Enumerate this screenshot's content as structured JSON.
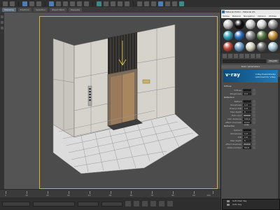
{
  "toolbar": {
    "tab_a": "Object Paint",
    "tab_b": "Populate"
  },
  "ribbon": {
    "tabs": [
      "Modeling",
      "Freeform",
      "Selection",
      "Object Paint",
      "Populate"
    ],
    "active": 0
  },
  "viewport": {
    "label": "[+] [Perspective] [Standard] [Default Shading]"
  },
  "timeline": {
    "ticks": [
      "0",
      "10",
      "20",
      "30",
      "40",
      "50",
      "60",
      "70",
      "80",
      "90",
      "100"
    ]
  },
  "material_editor": {
    "title": "Material Editor - Material #1",
    "menu": [
      "Modes",
      "Material",
      "Navigation",
      "Options",
      "Utilities"
    ],
    "material_name": "Material #1",
    "type_button": "VRayMtl",
    "rollout_basic": "Basic parameters",
    "vray_logo": "v·ray",
    "vray_tagline": "V-Ray PowerShader",
    "vray_tagline2": "optimized for V-Ray",
    "diffuse_section": "Diffuse",
    "reflection_section": "Reflection",
    "refraction_section": "Refraction",
    "sphere_colors": [
      "#c8c8c8",
      "#101010",
      "#cfcfcf",
      "#d9d9d9",
      "#9e9e9e",
      "#3aa0b8",
      "#2e6cc0",
      "#8a8a8a",
      "#5a7d45",
      "#c9963a",
      "#c04b3d",
      "#6fa0c8",
      "#d8d3c0",
      "#6b6b6b",
      "#a8c8d8"
    ],
    "rows_diffuse": [
      {
        "label": "Diffuse",
        "value": ""
      },
      {
        "label": "Roughness",
        "value": "0.0"
      }
    ],
    "rows_reflect": [
      {
        "label": "Reflect",
        "value": ""
      },
      {
        "label": "Glossiness",
        "value": "1.0"
      },
      {
        "label": "Fresnel IOR",
        "value": "1.6"
      },
      {
        "label": "Max depth",
        "value": "5"
      },
      {
        "label": "Exit color",
        "value": ""
      },
      {
        "label": "Dim distance",
        "value": "100.0"
      },
      {
        "label": "Affect channels",
        "value": "Color only"
      }
    ],
    "rows_refract": [
      {
        "label": "Refract",
        "value": ""
      },
      {
        "label": "Glossiness",
        "value": "1.0"
      },
      {
        "label": "IOR",
        "value": "1.6"
      },
      {
        "label": "Max depth",
        "value": "5"
      },
      {
        "label": "Affect shadows",
        "value": ""
      },
      {
        "label": "Abbe number",
        "value": "50.0"
      }
    ]
  },
  "bottom_popup": {
    "rows": [
      "Soft Shell Tag",
      "Auto Key"
    ]
  }
}
